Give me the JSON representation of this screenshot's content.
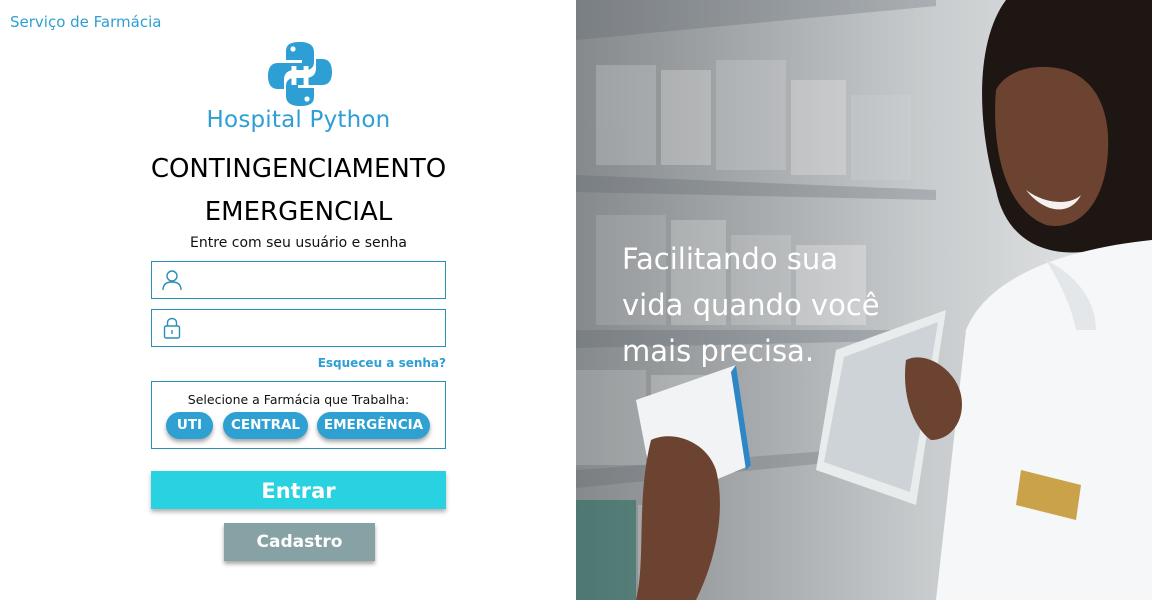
{
  "header": {
    "service_label": "Serviço de Farmácia"
  },
  "brand": {
    "name": "Hospital Python",
    "logo_letter": "H",
    "logo_color": "#2e9fd4"
  },
  "title": {
    "line1": "CONTINGENCIAMENTO",
    "line2": "EMERGENCIAL"
  },
  "login": {
    "instruction": "Entre com seu usuário e senha",
    "username": {
      "value": "",
      "placeholder": "",
      "icon": "user-icon"
    },
    "password": {
      "value": "",
      "placeholder": "",
      "icon": "lock-icon"
    },
    "forgot_label": "Esqueceu a senha?"
  },
  "pharmacy": {
    "label": "Selecione a Farmácia que Trabalha:",
    "options": [
      "UTI",
      "CENTRAL",
      "EMERGÊNCIA"
    ]
  },
  "actions": {
    "enter_label": "Entrar",
    "signup_label": "Cadastro"
  },
  "hero": {
    "tagline_lines": [
      "Facilitando sua",
      "vida quando você",
      "mais precisa."
    ]
  },
  "colors": {
    "accent": "#2e9fd4",
    "enter_button": "#29d2e0",
    "signup_button": "#87a2a4",
    "field_border": "#2a8fb6"
  }
}
